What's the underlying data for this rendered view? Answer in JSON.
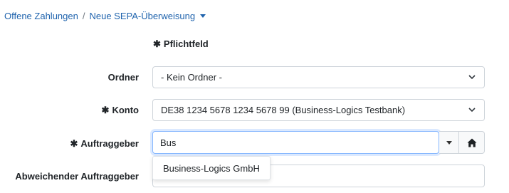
{
  "breadcrumb": {
    "item1": "Offene Zahlungen",
    "separator": "/",
    "item2": "Neue SEPA-Überweisung"
  },
  "form": {
    "required_star": "✱",
    "required_note": "Pflichtfeld",
    "ordner": {
      "label": "Ordner",
      "value": "- Kein Ordner -"
    },
    "konto": {
      "label": "Konto",
      "value": "DE38 1234 5678 1234 5678 99 (Business-Logics Testbank)"
    },
    "auftraggeber": {
      "label": "Auftraggeber",
      "value": "Bus"
    },
    "abweichender": {
      "label": "Abweichender Auftraggeber",
      "value": ""
    },
    "suggestions": [
      "Business-Logics GmbH"
    ]
  },
  "icons": {
    "chevron": "chevron-down-icon",
    "home": "home-icon",
    "caret": "caret-down-icon"
  },
  "colors": {
    "link": "#1f63ad",
    "focus_border": "#86b7fe"
  }
}
